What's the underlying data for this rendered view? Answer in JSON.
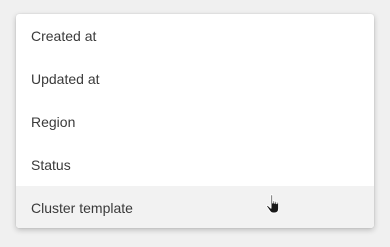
{
  "menu": {
    "items": [
      {
        "label": "Created at"
      },
      {
        "label": "Updated at"
      },
      {
        "label": "Region"
      },
      {
        "label": "Status"
      },
      {
        "label": "Cluster template",
        "hovered": true
      }
    ]
  },
  "cursor": {
    "icon": "pointer-hand-icon"
  }
}
